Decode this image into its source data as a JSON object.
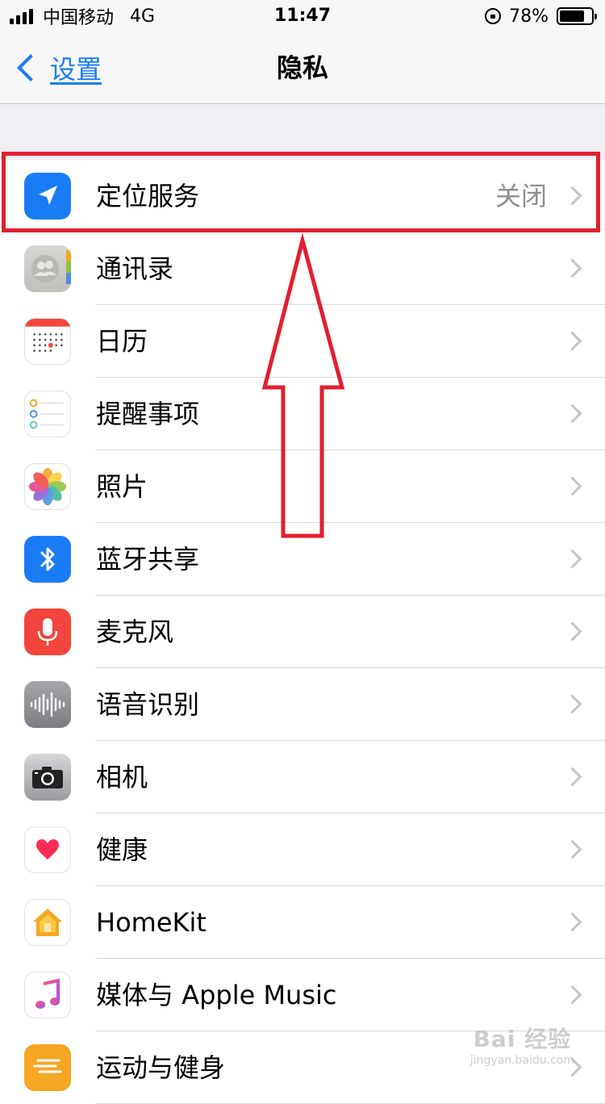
{
  "status_bar": {
    "carrier": "中国移动",
    "network": "4G",
    "time": "11:47",
    "battery_percent": "78%",
    "battery_level": 0.78
  },
  "nav": {
    "back_label": "设置",
    "title": "隐私"
  },
  "rows": [
    {
      "label": "定位服务",
      "value": "关闭",
      "icon": "location-arrow-icon",
      "icon_color": "#1a7cf4"
    },
    {
      "label": "通讯录",
      "value": "",
      "icon": "contacts-icon",
      "icon_color": "#c9c8c4"
    },
    {
      "label": "日历",
      "value": "",
      "icon": "calendar-icon",
      "icon_color": "#ffffff"
    },
    {
      "label": "提醒事项",
      "value": "",
      "icon": "reminders-icon",
      "icon_color": "#ffffff"
    },
    {
      "label": "照片",
      "value": "",
      "icon": "photos-icon",
      "icon_color": "#ffffff"
    },
    {
      "label": "蓝牙共享",
      "value": "",
      "icon": "bluetooth-icon",
      "icon_color": "#1a7cf4"
    },
    {
      "label": "麦克风",
      "value": "",
      "icon": "microphone-icon",
      "icon_color": "#f2453d"
    },
    {
      "label": "语音识别",
      "value": "",
      "icon": "speech-waveform-icon",
      "icon_color": "#8e8e93"
    },
    {
      "label": "相机",
      "value": "",
      "icon": "camera-icon",
      "icon_color": "#b5b5b8"
    },
    {
      "label": "健康",
      "value": "",
      "icon": "health-heart-icon",
      "icon_color": "#ffffff"
    },
    {
      "label": "HomeKit",
      "value": "",
      "icon": "homekit-icon",
      "icon_color": "#ffffff"
    },
    {
      "label": "媒体与 Apple Music",
      "value": "",
      "icon": "music-note-icon",
      "icon_color": "#ffffff"
    },
    {
      "label": "运动与健身",
      "value": "",
      "icon": "motion-fitness-icon",
      "icon_color": "#f5a623"
    }
  ],
  "annotation": {
    "highlight_color": "#e21f2f"
  },
  "watermark": {
    "main": "Bai 经验",
    "sub": "jingyan.baidu.com"
  }
}
